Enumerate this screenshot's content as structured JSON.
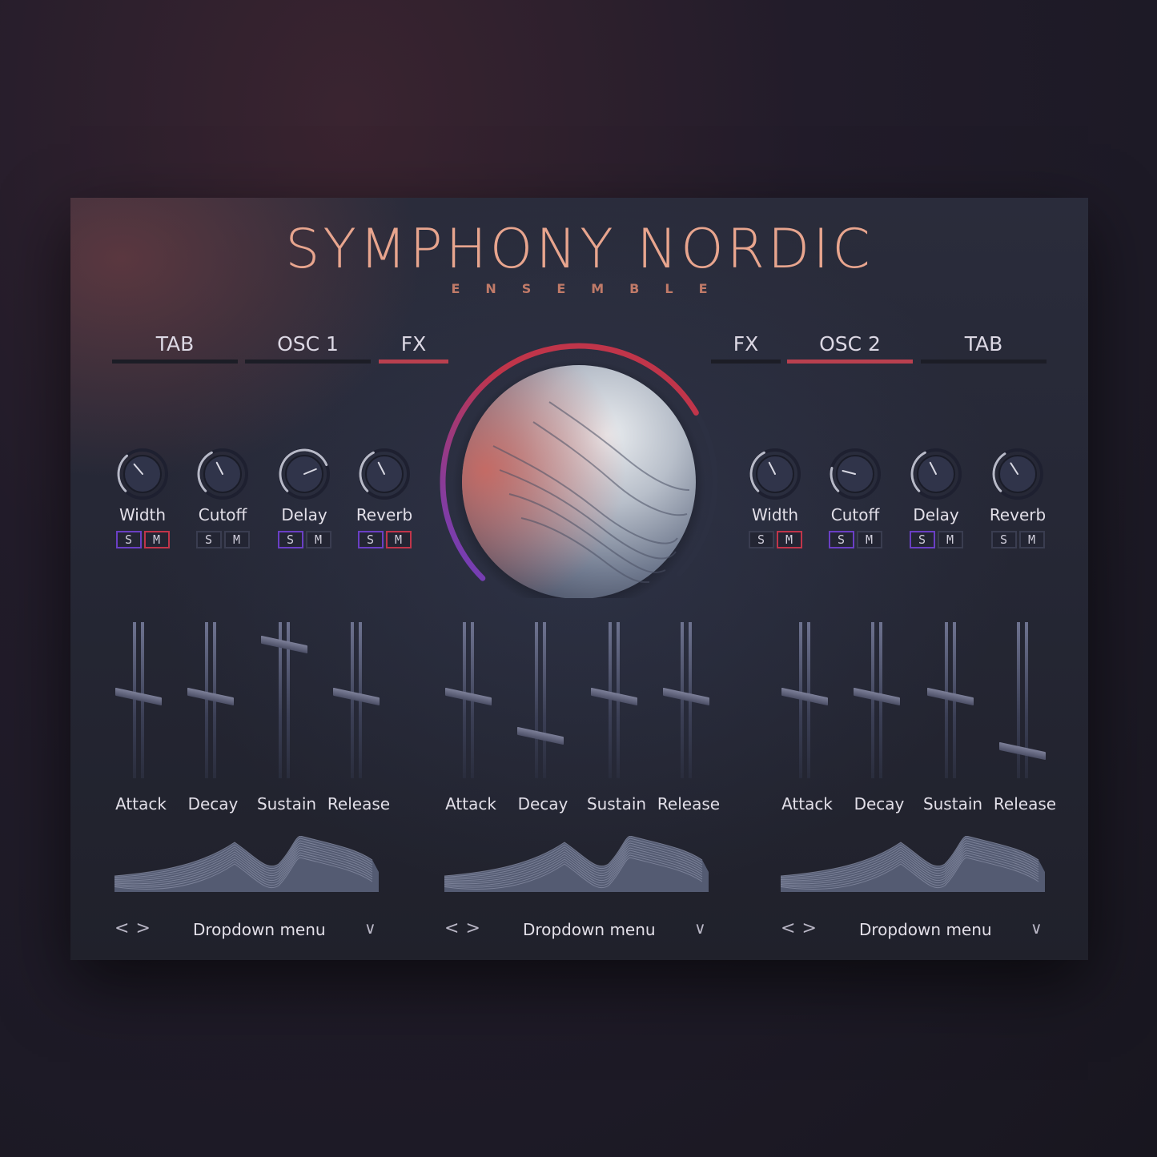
{
  "header": {
    "title": "SYMPHONY NORDIC",
    "subtitle": "ENSEMBLE"
  },
  "tabs": {
    "left": [
      {
        "label": "TAB",
        "active": false
      },
      {
        "label": "OSC 1",
        "active": false
      },
      {
        "label": "FX",
        "active": true
      }
    ],
    "right": [
      {
        "label": "FX",
        "active": false
      },
      {
        "label": "OSC 2",
        "active": true
      },
      {
        "label": "TAB",
        "active": false
      }
    ]
  },
  "knobs": {
    "left": [
      {
        "label": "Width",
        "solo": "S",
        "mute": "M",
        "solo_on": true,
        "mute_on": true,
        "value": 0.35
      },
      {
        "label": "Cutoff",
        "solo": "S",
        "mute": "M",
        "solo_on": false,
        "mute_on": false,
        "value": 0.4
      },
      {
        "label": "Delay",
        "solo": "S",
        "mute": "M",
        "solo_on": true,
        "mute_on": false,
        "value": 0.75
      },
      {
        "label": "Reverb",
        "solo": "S",
        "mute": "M",
        "solo_on": true,
        "mute_on": true,
        "value": 0.4
      }
    ],
    "right": [
      {
        "label": "Width",
        "solo": "S",
        "mute": "M",
        "solo_on": false,
        "mute_on": true,
        "value": 0.4
      },
      {
        "label": "Cutoff",
        "solo": "S",
        "mute": "M",
        "solo_on": true,
        "mute_on": false,
        "value": 0.22
      },
      {
        "label": "Delay",
        "solo": "S",
        "mute": "M",
        "solo_on": true,
        "mute_on": false,
        "value": 0.4
      },
      {
        "label": "Reverb",
        "solo": "S",
        "mute": "M",
        "solo_on": false,
        "mute_on": false,
        "value": 0.38
      }
    ]
  },
  "master": {
    "value": 0.72
  },
  "envelopes": [
    {
      "faders": [
        {
          "label": "Attack",
          "value": 0.55
        },
        {
          "label": "Decay",
          "value": 0.55
        },
        {
          "label": "Sustain",
          "value": 0.88
        },
        {
          "label": "Release",
          "value": 0.55
        }
      ],
      "dropdown": "Dropdown menu"
    },
    {
      "faders": [
        {
          "label": "Attack",
          "value": 0.55
        },
        {
          "label": "Decay",
          "value": 0.3
        },
        {
          "label": "Sustain",
          "value": 0.55
        },
        {
          "label": "Release",
          "value": 0.55
        }
      ],
      "dropdown": "Dropdown menu"
    },
    {
      "faders": [
        {
          "label": "Attack",
          "value": 0.55
        },
        {
          "label": "Decay",
          "value": 0.55
        },
        {
          "label": "Sustain",
          "value": 0.55
        },
        {
          "label": "Release",
          "value": 0.2
        }
      ],
      "dropdown": "Dropdown menu"
    }
  ],
  "nav": {
    "prev": "<",
    "next": ">",
    "chevron": "∨"
  },
  "colors": {
    "accent_red": "#c0354a",
    "accent_purple": "#6a3fc4",
    "title": "#e8a58e"
  }
}
